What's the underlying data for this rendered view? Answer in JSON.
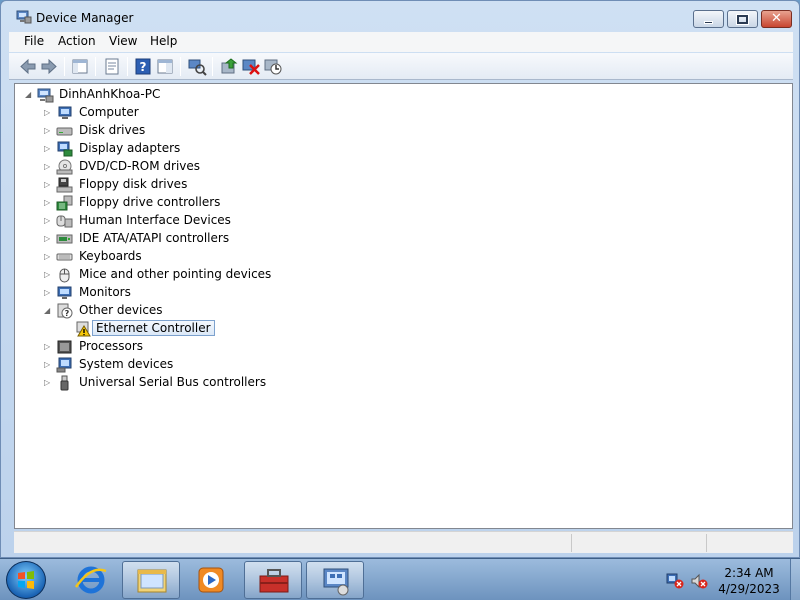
{
  "window": {
    "title": "Device Manager",
    "icon": "device-manager-icon"
  },
  "menu": {
    "items": [
      {
        "label": "File"
      },
      {
        "label": "Action"
      },
      {
        "label": "View"
      },
      {
        "label": "Help"
      }
    ]
  },
  "toolbar": {
    "buttons": [
      "back-icon",
      "forward-icon",
      "show-hide-tree-icon",
      "properties-icon",
      "help-icon",
      "action-pane-icon",
      "scan-hardware-icon",
      "update-driver-icon",
      "uninstall-icon",
      "disable-icon"
    ]
  },
  "tree": {
    "root": {
      "label": "DinhAnhKhoa-PC",
      "icon": "computer-icon"
    },
    "categories": [
      {
        "label": "Computer",
        "icon": "computer-icon",
        "expanded": false
      },
      {
        "label": "Disk drives",
        "icon": "disk-drive-icon",
        "expanded": false
      },
      {
        "label": "Display adapters",
        "icon": "display-adapter-icon",
        "expanded": false
      },
      {
        "label": "DVD/CD-ROM drives",
        "icon": "dvd-drive-icon",
        "expanded": false
      },
      {
        "label": "Floppy disk drives",
        "icon": "floppy-drive-icon",
        "expanded": false
      },
      {
        "label": "Floppy drive controllers",
        "icon": "floppy-controller-icon",
        "expanded": false
      },
      {
        "label": "Human Interface Devices",
        "icon": "hid-icon",
        "expanded": false
      },
      {
        "label": "IDE ATA/ATAPI controllers",
        "icon": "ide-controller-icon",
        "expanded": false
      },
      {
        "label": "Keyboards",
        "icon": "keyboard-icon",
        "expanded": false
      },
      {
        "label": "Mice and other pointing devices",
        "icon": "mouse-icon",
        "expanded": false
      },
      {
        "label": "Monitors",
        "icon": "monitor-icon",
        "expanded": false
      },
      {
        "label": "Other devices",
        "icon": "unknown-device-icon",
        "expanded": true
      },
      {
        "label": "Processors",
        "icon": "processor-icon",
        "expanded": false
      },
      {
        "label": "System devices",
        "icon": "system-device-icon",
        "expanded": false
      },
      {
        "label": "Universal Serial Bus controllers",
        "icon": "usb-icon",
        "expanded": false
      }
    ],
    "child": {
      "label": "Ethernet Controller",
      "icon": "warning-device-icon",
      "selected": true
    }
  },
  "taskbar": {
    "apps": [
      "internet-explorer-icon",
      "windows-explorer-icon",
      "media-player-icon",
      "toolbox-icon",
      "device-manager-icon"
    ],
    "tray": [
      "network-error-icon",
      "volume-muted-icon"
    ],
    "time": "2:34 AM",
    "date": "4/29/2023"
  },
  "colors": {
    "selection_border": "#7da2ce",
    "window_frame": "#bcd2ec",
    "taskbar": "#6d93be"
  }
}
